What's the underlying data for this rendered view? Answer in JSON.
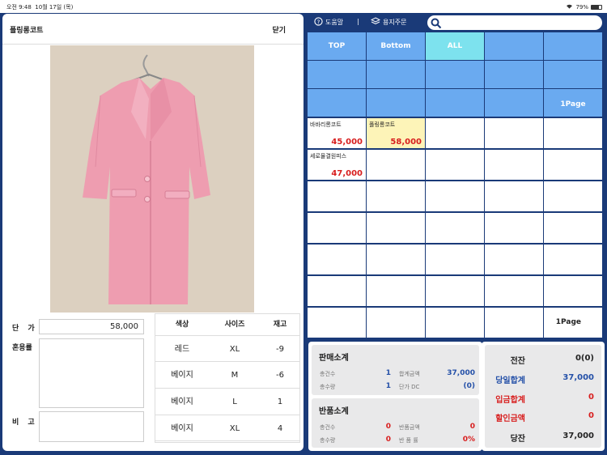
{
  "status": {
    "time": "오전 9:48",
    "date": "10월 17일 (목)",
    "battery": "79%",
    "battery_level": 0.79
  },
  "product_panel": {
    "title": "폴링롱코트",
    "close_label": "닫기",
    "price_label": "단 가",
    "price_value": "58,000",
    "mix_label": "혼용률",
    "mix_value": "",
    "memo_label": "비 고",
    "memo_value": "",
    "stock_headers": [
      "색상",
      "사이즈",
      "재고"
    ],
    "stock_rows": [
      {
        "color": "레드",
        "size": "XL",
        "qty": "-9"
      },
      {
        "color": "베이지",
        "size": "M",
        "qty": "-6"
      },
      {
        "color": "베이지",
        "size": "L",
        "qty": "1"
      },
      {
        "color": "베이지",
        "size": "XL",
        "qty": "4"
      }
    ]
  },
  "toolbar": {
    "help": "도움말",
    "sep": "|",
    "order": "용지주문",
    "search_placeholder": ""
  },
  "grid": {
    "categories": [
      "TOP",
      "Bottom",
      "ALL"
    ],
    "category_page": "1Page",
    "products": [
      {
        "name": "바바리롱코트",
        "price": "45,000"
      },
      {
        "name": "폴링롱코트",
        "price": "58,000"
      },
      {
        "name": "세로물결원피스",
        "price": "47,000"
      }
    ],
    "product_page": "1Page"
  },
  "sales": {
    "title": "판매소계",
    "count_label": "총건수",
    "count_value": "1",
    "amount_label": "합계금액",
    "amount_value": "37,000",
    "qty_label": "총수량",
    "qty_value": "1",
    "dc_label": "단가 DC",
    "dc_value": "(0)"
  },
  "returns": {
    "title": "반품소계",
    "count_label": "총건수",
    "count_value": "0",
    "amount_label": "반품금액",
    "amount_value": "0",
    "qty_label": "총수량",
    "qty_value": "0",
    "rate_label": "반 품 률",
    "rate_value": "0%"
  },
  "totals": {
    "prev_label": "전잔",
    "prev_value": "0(0)",
    "day_label": "당일합계",
    "day_value": "37,000",
    "deposit_label": "입금합계",
    "deposit_value": "0",
    "discount_label": "할인금액",
    "discount_value": "0",
    "balance_label": "당잔",
    "balance_value": "37,000"
  },
  "colors": {
    "navy": "#1a3a78",
    "category": "#6aaaf0",
    "category_active": "#7de2ee",
    "selected": "#fdf4b8",
    "price_red": "#d81e1e",
    "coat_pink": "#ee9db0"
  }
}
